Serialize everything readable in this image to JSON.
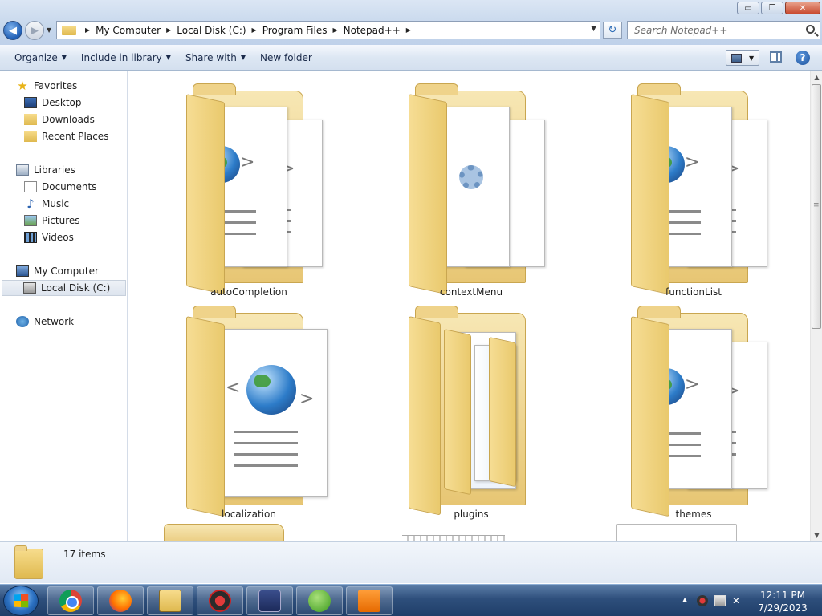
{
  "window": {
    "minimize": "▭",
    "restore": "❐",
    "close": "✕"
  },
  "nav": {
    "back": "◀",
    "forward": "▶",
    "history": "▼"
  },
  "address": {
    "crumbs": [
      "My Computer",
      "Local Disk (C:)",
      "Program Files",
      "Notepad++"
    ],
    "dropdown": "▼",
    "refresh": "↻"
  },
  "search": {
    "placeholder": "Search Notepad++"
  },
  "toolbar": {
    "organize": "Organize",
    "include_in_library": "Include in library",
    "share_with": "Share with",
    "new_folder": "New folder",
    "help": "?"
  },
  "sidebar": {
    "favorites": "Favorites",
    "desktop": "Desktop",
    "downloads": "Downloads",
    "recent_places": "Recent Places",
    "libraries": "Libraries",
    "documents": "Documents",
    "music": "Music",
    "pictures": "Pictures",
    "videos": "Videos",
    "my_computer": "My Computer",
    "local_disk": "Local Disk (C:)",
    "network": "Network"
  },
  "folders": [
    {
      "name": "autoCompletion",
      "icon": "web-document-folder-icon"
    },
    {
      "name": "contextMenu",
      "icon": "settings-document-folder-icon"
    },
    {
      "name": "functionList",
      "icon": "web-document-folder-icon"
    },
    {
      "name": "localization",
      "icon": "web-document-folder-icon"
    },
    {
      "name": "plugins",
      "icon": "folder-icon"
    },
    {
      "name": "themes",
      "icon": "web-document-folder-icon"
    }
  ],
  "details": {
    "count": "17 items"
  },
  "taskbar": {
    "apps": [
      "chrome-icon",
      "firefox-icon",
      "windows-explorer-icon",
      "app-red-icon",
      "app-blue-icon",
      "utorrent-icon",
      "pdf-icon"
    ],
    "clock_time": "12:11 PM",
    "clock_date": "7/29/2023"
  },
  "colors": {
    "accent": "#2e4f7c",
    "folder": "#e9c96d"
  }
}
